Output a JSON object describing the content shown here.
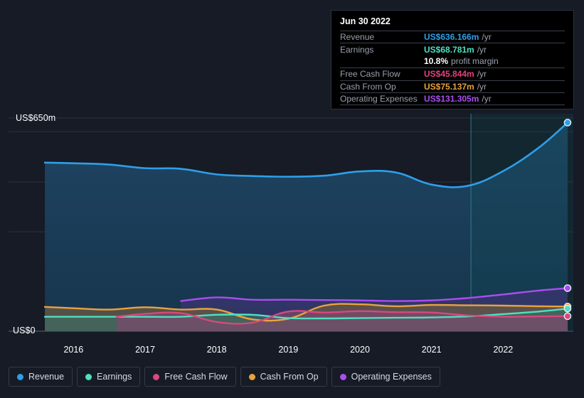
{
  "axis": {
    "y_top_label": "US$650m",
    "y_zero_label": "US$0",
    "x_ticks": [
      "2016",
      "2017",
      "2018",
      "2019",
      "2020",
      "2021",
      "2022"
    ]
  },
  "tooltip": {
    "date": "Jun 30 2022",
    "rows": [
      {
        "label": "Revenue",
        "value": "US$636.166m",
        "suffix": "/yr",
        "color": "#2e9fe8"
      },
      {
        "label": "Earnings",
        "value": "US$68.781m",
        "suffix": "/yr",
        "color": "#4fe0c0"
      },
      {
        "label": "",
        "value": "10.8%",
        "suffix": "profit margin",
        "color": "#ffffff"
      },
      {
        "label": "Free Cash Flow",
        "value": "US$45.844m",
        "suffix": "/yr",
        "color": "#e8407e"
      },
      {
        "label": "Cash From Op",
        "value": "US$75.137m",
        "suffix": "/yr",
        "color": "#e8a33d"
      },
      {
        "label": "Operating Expenses",
        "value": "US$131.305m",
        "suffix": "/yr",
        "color": "#ab4df0"
      }
    ]
  },
  "legend": [
    {
      "label": "Revenue",
      "color": "#2e9fe8"
    },
    {
      "label": "Earnings",
      "color": "#4fe0c0"
    },
    {
      "label": "Free Cash Flow",
      "color": "#d8487e"
    },
    {
      "label": "Cash From Op",
      "color": "#e8a33d"
    },
    {
      "label": "Operating Expenses",
      "color": "#ab4df0"
    }
  ],
  "chart_data": {
    "type": "area",
    "title": "",
    "xlabel": "",
    "ylabel": "",
    "ylim": [
      0,
      650
    ],
    "y_unit": "US$m",
    "grid": true,
    "legend_position": "bottom",
    "x_range": [
      "2015-06",
      "2022-12"
    ],
    "forecast_boundary": "2021-06",
    "series": [
      {
        "name": "Revenue",
        "color": "#2e9fe8",
        "fill": "#1d3a54",
        "x": [
          "2015.6",
          "2016.0",
          "2016.5",
          "2017.0",
          "2017.5",
          "2018.0",
          "2018.5",
          "2019.0",
          "2019.5",
          "2020.0",
          "2020.5",
          "2021.0",
          "2021.5",
          "2022.0",
          "2022.5",
          "2022.9"
        ],
        "values": [
          514,
          512,
          508,
          497,
          495,
          478,
          473,
          471,
          474,
          487,
          484,
          447,
          443,
          488,
          560,
          636
        ]
      },
      {
        "name": "Earnings",
        "color": "#4fe0c0",
        "fill": "#3f6b63",
        "x": [
          "2015.6",
          "2016.0",
          "2016.5",
          "2017.0",
          "2017.5",
          "2018.0",
          "2018.5",
          "2019.0",
          "2019.5",
          "2020.0",
          "2020.5",
          "2021.0",
          "2021.5",
          "2022.0",
          "2022.5",
          "2022.9"
        ],
        "values": [
          44,
          44,
          44,
          44,
          44,
          50,
          50,
          40,
          39,
          40,
          41,
          42,
          45,
          52,
          60,
          68.781
        ]
      },
      {
        "name": "Free Cash Flow",
        "color": "#d8487e",
        "fill": "#7a4a6e",
        "x": [
          "2016.6",
          "2017.0",
          "2017.5",
          "2018.0",
          "2018.5",
          "2019.0",
          "2019.5",
          "2020.0",
          "2020.5",
          "2021.0",
          "2021.5",
          "2022.0",
          "2022.5",
          "2022.9"
        ],
        "values": [
          44,
          53,
          55,
          28,
          26,
          60,
          57,
          61,
          58,
          57,
          48,
          44,
          45,
          45.844
        ]
      },
      {
        "name": "Cash From Op",
        "color": "#e8a33d",
        "fill": "#6e5c44",
        "x": [
          "2015.6",
          "2016.0",
          "2016.5",
          "2017.0",
          "2017.5",
          "2018.0",
          "2018.5",
          "2019.0",
          "2019.5",
          "2020.0",
          "2020.5",
          "2021.0",
          "2021.5",
          "2022.0",
          "2022.5",
          "2022.9"
        ],
        "values": [
          74,
          70,
          66,
          73,
          66,
          66,
          36,
          38,
          78,
          82,
          76,
          80,
          79,
          78,
          76,
          75.137
        ]
      },
      {
        "name": "Operating Expenses",
        "color": "#ab4df0",
        "fill": "#3b3570",
        "x": [
          "2017.5",
          "2018.0",
          "2018.5",
          "2019.0",
          "2019.5",
          "2020.0",
          "2020.5",
          "2021.0",
          "2021.5",
          "2022.0",
          "2022.5",
          "2022.9"
        ],
        "values": [
          92,
          103,
          96,
          96,
          95,
          94,
          92,
          94,
          101,
          112,
          124,
          131.305
        ]
      }
    ]
  }
}
